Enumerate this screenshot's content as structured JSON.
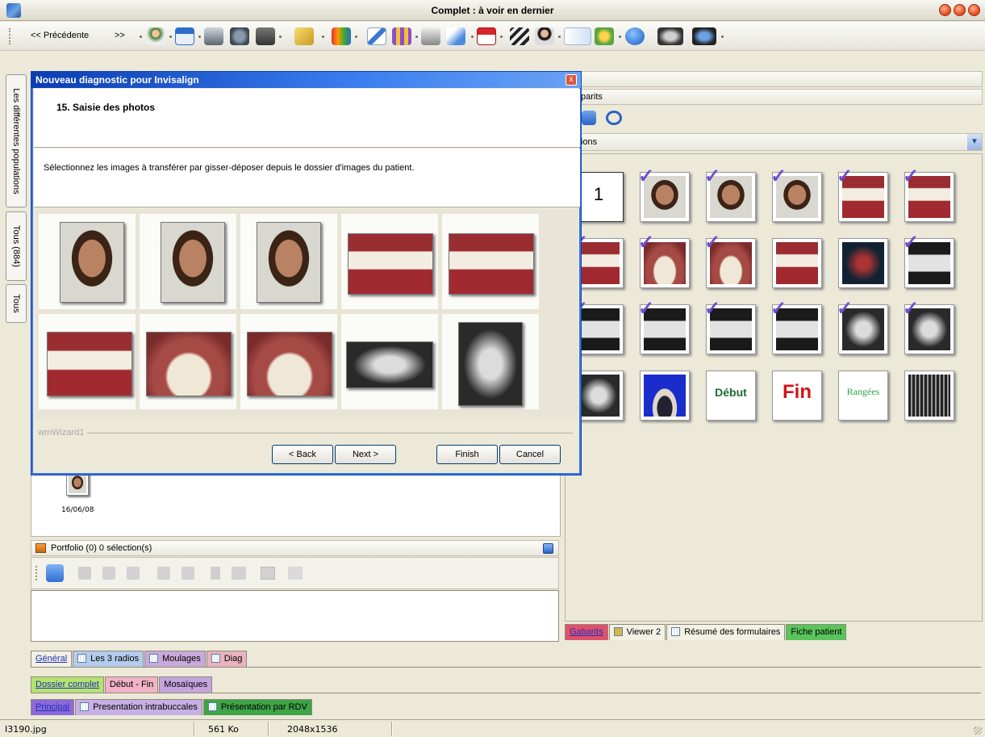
{
  "window": {
    "title": "Complet : à voir en dernier"
  },
  "toolbar": {
    "prev_label": "<< Précédente",
    "next_label": ">>"
  },
  "left_tabs": [
    "Les différentes populations",
    "Tous (884)",
    "Tous"
  ],
  "right_panel": {
    "bar1_text": "parits",
    "bar3_text": "ions",
    "number_tile": "1",
    "tile_debut": "Début",
    "tile_fin": "Fin",
    "tile_ranges": "Rangées"
  },
  "dialog": {
    "title": "Nouveau diagnostic pour Invisalign",
    "step": "15. Saisie des photos",
    "instruction": "Sélectionnez les images à transférer par gisser-déposer depuis le dossier d'images du patient.",
    "group_label": "wmWizard1",
    "buttons": {
      "back": "< Back",
      "next": "Next >",
      "finish": "Finish",
      "cancel": "Cancel"
    }
  },
  "left_work": {
    "thumb_date": "16/06/08"
  },
  "portfolio": {
    "title": "Portfolio (0) 0 sélection(s)"
  },
  "right_tabs": [
    "Gabarits",
    "Viewer 2",
    "Résumé des formulaires",
    "Fiche patient"
  ],
  "tab_rows": {
    "row1": [
      "Général",
      "Les 3 radios",
      "Moulages",
      "Diag"
    ],
    "row2": [
      "Dossier complet",
      "Début - Fin",
      "Mosaïques"
    ],
    "row3": [
      "Principal",
      "Presentation intrabuccales",
      "Présentation par RDV"
    ]
  },
  "status": {
    "file": "I3190.jpg",
    "size": "561 Ko",
    "dims": "2048x1536"
  },
  "colors": {
    "dialog_title": "#0a3db1",
    "check": "#6d4ccf",
    "accent_blue": "#3b7ef0"
  }
}
